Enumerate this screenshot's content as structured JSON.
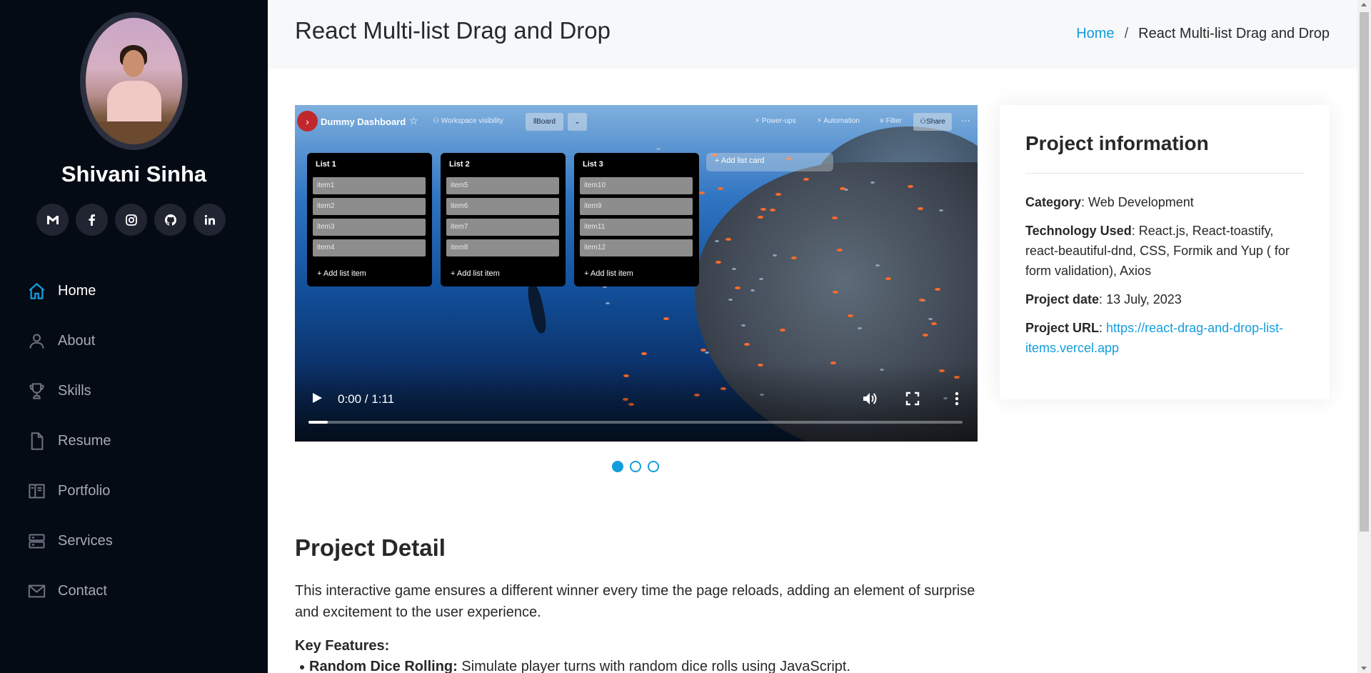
{
  "profile": {
    "name": "Shivani Sinha"
  },
  "socials": [
    {
      "icon": "gmail-icon"
    },
    {
      "icon": "facebook-icon"
    },
    {
      "icon": "instagram-icon"
    },
    {
      "icon": "github-icon"
    },
    {
      "icon": "linkedin-icon"
    }
  ],
  "nav": {
    "items": [
      {
        "label": "Home",
        "icon": "home-icon",
        "active": true
      },
      {
        "label": "About",
        "icon": "person-icon"
      },
      {
        "label": "Skills",
        "icon": "trophy-icon"
      },
      {
        "label": "Resume",
        "icon": "file-icon"
      },
      {
        "label": "Portfolio",
        "icon": "book-icon"
      },
      {
        "label": "Services",
        "icon": "server-icon"
      },
      {
        "label": "Contact",
        "icon": "envelope-icon"
      }
    ]
  },
  "header": {
    "title": "React Multi-list Drag and Drop",
    "breadcrumb": {
      "home": "Home",
      "separator": "/",
      "current": "React Multi-list Drag and Drop"
    }
  },
  "video": {
    "board": {
      "title": "Dummy Dashboard",
      "visibility": "Workspace visibility",
      "view": "Board",
      "power_ups": "Power-ups",
      "automation": "Automation",
      "filter": "Filter",
      "share": "Share",
      "add_list_card": "Add list card",
      "lists": [
        {
          "title": "List 1",
          "items": [
            "item1",
            "item2",
            "item3",
            "item4"
          ],
          "add": "Add list item"
        },
        {
          "title": "List 2",
          "items": [
            "item5",
            "item6",
            "item7",
            "item8"
          ],
          "add": "Add list item"
        },
        {
          "title": "List 3",
          "items": [
            "item10",
            "item9",
            "item11",
            "item12"
          ],
          "add": "Add list item"
        }
      ]
    },
    "time": "0:00 / 1:11",
    "progress": 0.03
  },
  "carousel": {
    "count": 3,
    "active": 0
  },
  "info": {
    "heading": "Project information",
    "category_label": "Category",
    "category": "Web Development",
    "tech_label": "Technology Used",
    "tech": "React.js, React-toastify, react-beautiful-dnd, CSS, Formik and Yup ( for form validation), Axios",
    "date_label": "Project date",
    "date": "13 July, 2023",
    "url_label": "Project URL",
    "url": "https://react-drag-and-drop-list-items.vercel.app"
  },
  "detail": {
    "title": "Project Detail",
    "text": "This interactive game ensures a different winner every time the page reloads, adding an element of surprise and excitement to the user experience.",
    "features_title": "Key Features:",
    "feature1_label": "Random Dice Rolling:",
    "feature1_text": "Simulate player turns with random dice rolls using JavaScript."
  },
  "colors": {
    "accent": "#149ddd",
    "sidebar": "#040b14",
    "header_bg": "#f7f8f9"
  }
}
